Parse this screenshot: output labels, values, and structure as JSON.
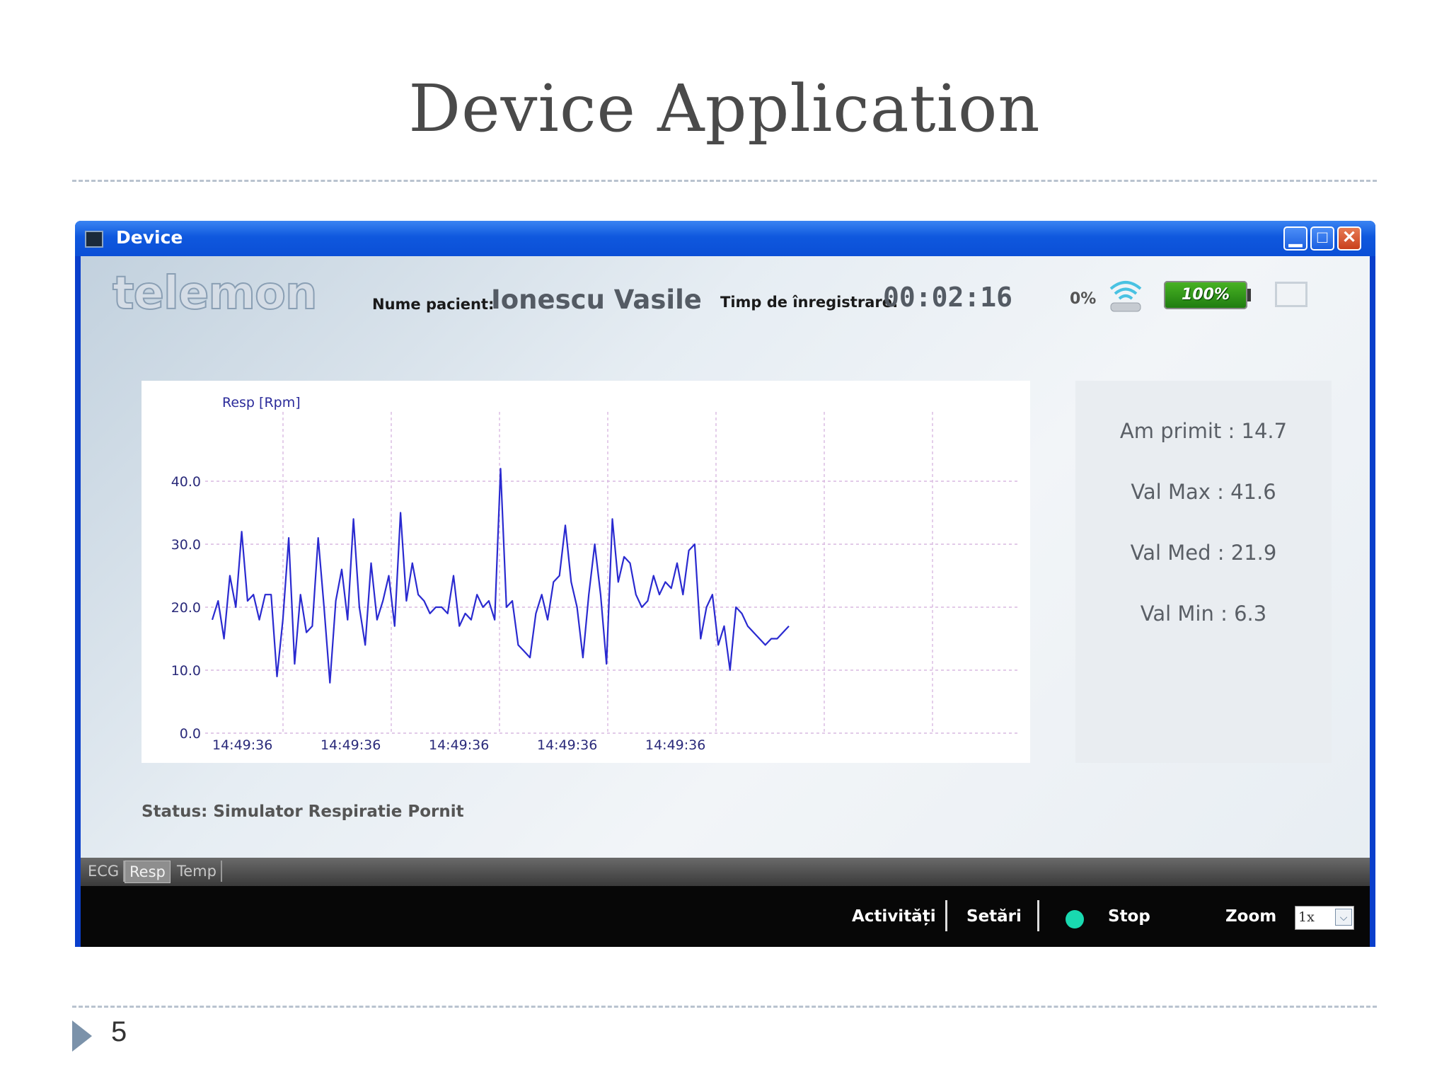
{
  "slide": {
    "title": "Device Application",
    "page_number": "5"
  },
  "window": {
    "title": "Device",
    "minimize": "▁",
    "maximize": "□",
    "close": "✕"
  },
  "header": {
    "logo": "telemon",
    "patient_label": "Nume pacient:",
    "patient_name": "Ionescu Vasile",
    "time_label": "Timp de înregistrare:",
    "time_value": "00:02:16",
    "signal": "0%",
    "battery": "100%"
  },
  "stats": {
    "received": "Am primit : 14.7",
    "max": "Val Max : 41.6",
    "med": "Val Med : 21.9",
    "min": "Val Min : 6.3"
  },
  "status_text": "Status: Simulator Respiratie Pornit",
  "tabs": [
    "ECG",
    "Resp",
    "Temp"
  ],
  "active_tab": "Resp",
  "bottom": {
    "activities": "Activități",
    "settings": "Setări",
    "stop": "Stop",
    "zoom_label": "Zoom",
    "zoom_value": "1x",
    "status_color": "#19d9b0"
  },
  "chart_data": {
    "type": "line",
    "ylabel": "Resp [Rpm]",
    "ylim": [
      0,
      40
    ],
    "yticks": [
      "0.0",
      "10.0",
      "20.0",
      "30.0",
      "40.0"
    ],
    "x_tick_labels": [
      "14:49:36",
      "14:49:36",
      "14:49:36",
      "14:49:36",
      "14:49:36"
    ],
    "grid": true,
    "series": [
      {
        "color": "#2a2ad0",
        "values": [
          18,
          21,
          15,
          25,
          20,
          32,
          21,
          22,
          18,
          22,
          22,
          9,
          18,
          31,
          11,
          22,
          16,
          17,
          31,
          20,
          8,
          21,
          26,
          18,
          34,
          20,
          14,
          27,
          18,
          21,
          25,
          17,
          35,
          21,
          27,
          22,
          21,
          19,
          20,
          20,
          19,
          25,
          17,
          19,
          18,
          22,
          20,
          21,
          18,
          42,
          20,
          21,
          14,
          13,
          12,
          19,
          22,
          18,
          24,
          25,
          33,
          24,
          20,
          12,
          22,
          30,
          22,
          11,
          34,
          24,
          28,
          27,
          22,
          20,
          21,
          25,
          22,
          24,
          23,
          27,
          22,
          29,
          30,
          15,
          20,
          22,
          14,
          17,
          10,
          20,
          19,
          17,
          16,
          15,
          14,
          15,
          15,
          16,
          17
        ]
      }
    ]
  }
}
